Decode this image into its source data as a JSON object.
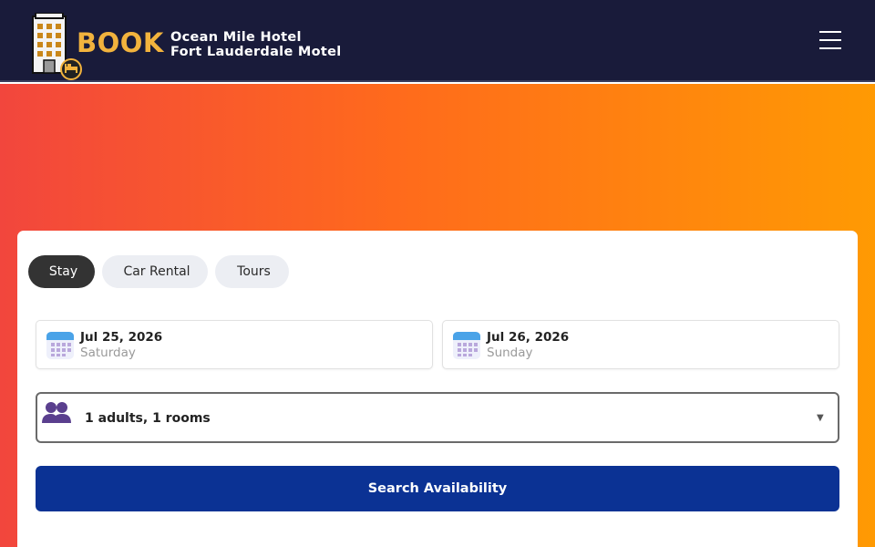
{
  "brand": {
    "logo_text": "BOOK",
    "name_line1": "Ocean Mile Hotel",
    "name_line2": "Fort Lauderdale Motel"
  },
  "colors": {
    "header_bg": "#191b3a",
    "logo_accent": "#f2b33d",
    "hero_gradient": [
      "#f2463d",
      "#ff6a1c",
      "#ff9a03"
    ],
    "tab_active_bg": "#333333",
    "tab_inactive_bg": "#eceef3",
    "primary_button": "#0b3294",
    "calendar_accent": "#4aa3e8",
    "guests_icon": "#5a3f8e"
  },
  "tabs": [
    {
      "glyph": "",
      "label": "Stay",
      "active": true,
      "icon": "bed-icon"
    },
    {
      "glyph": "",
      "label": "Car Rental",
      "active": false,
      "icon": "car-icon"
    },
    {
      "glyph": "",
      "label": "Tours",
      "active": false,
      "icon": "map-icon"
    }
  ],
  "checkin": {
    "date": "Jul 25, 2026",
    "day": "Saturday",
    "icon": "calendar-icon"
  },
  "checkout": {
    "date": "Jul 26, 2026",
    "day": "Sunday",
    "icon": "calendar-icon"
  },
  "guests": {
    "value": "1 adults, 1 rooms",
    "caret": "▼",
    "icon": "users-icon"
  },
  "search": {
    "label": "Search Availability"
  },
  "menu": {
    "icon": "hamburger-menu-icon"
  }
}
